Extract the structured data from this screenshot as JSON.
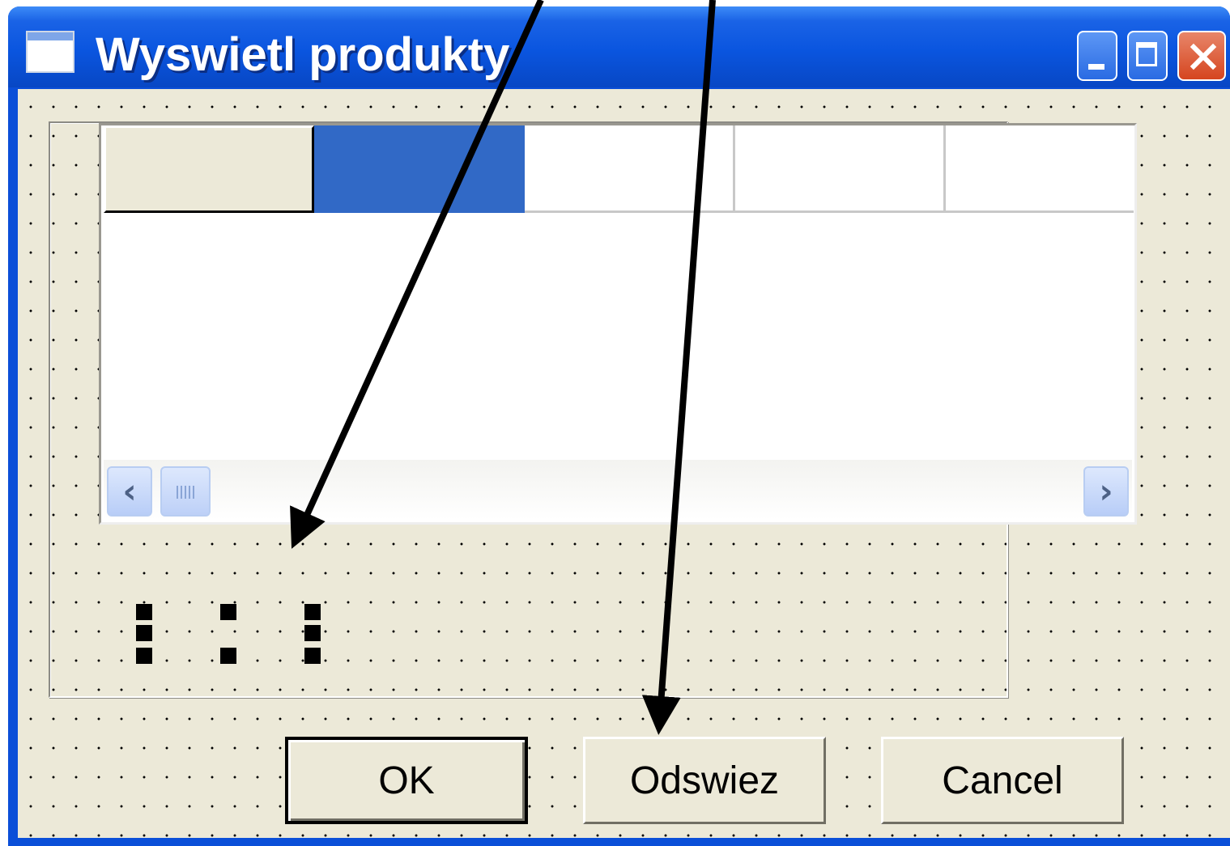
{
  "window": {
    "title": "Wyswietl produkty",
    "controls": [
      "minimize-icon",
      "maximize-icon",
      "close-icon"
    ]
  },
  "grid": {
    "columns": [
      "",
      "",
      "",
      "",
      ""
    ],
    "selected_column_color": "#3169c6",
    "scrollbar": {
      "left_arrow": "‹",
      "right_arrow": "›"
    }
  },
  "buttons": {
    "ok": "OK",
    "refresh": "Odswiez",
    "cancel": "Cancel"
  },
  "colors": {
    "titlebar": "#0a55df",
    "client": "#ece9d8",
    "arrow": "#000000"
  }
}
